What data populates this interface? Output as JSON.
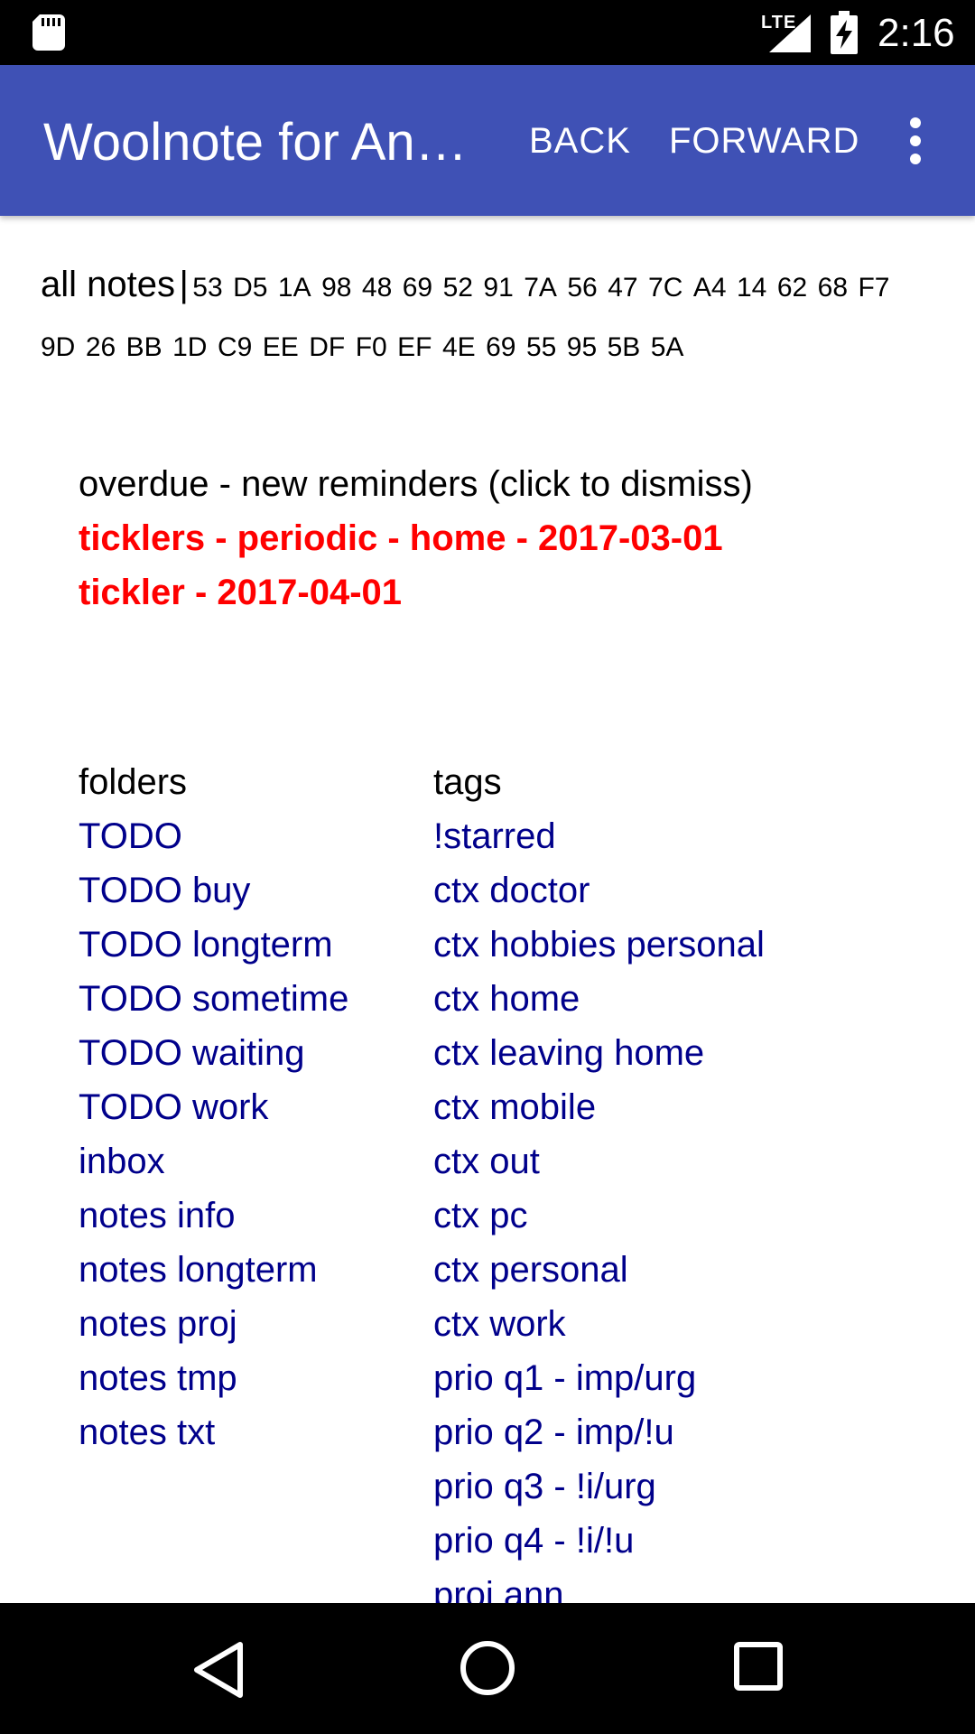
{
  "status_bar": {
    "network_label": "LTE",
    "time": "2:16",
    "icons": [
      "sd-card-icon",
      "signal-icon",
      "battery-charging-icon"
    ]
  },
  "app_bar": {
    "title": "Woolnote for An…",
    "back_label": "BACK",
    "forward_label": "FORWARD",
    "overflow_icon": "more-vert-icon",
    "color": "#3f51b5"
  },
  "header": {
    "all_notes_label": "all notes",
    "separator": "|",
    "ids": [
      "53",
      "D5",
      "1A",
      "98",
      "48",
      "69",
      "52",
      "91",
      "7A",
      "56",
      "47",
      "7C",
      "A4",
      "14",
      "62",
      "68",
      "F7",
      "9D",
      "26",
      "BB",
      "1D",
      "C9",
      "EE",
      "DF",
      "F0",
      "EF",
      "4E",
      "69",
      "55",
      "95",
      "5B",
      "5A"
    ]
  },
  "reminders": {
    "title": "overdue - new reminders (click to dismiss)",
    "items": [
      "ticklers - periodic - home - 2017-03-01",
      "tickler - 2017-04-01"
    ],
    "color": "#ff0000"
  },
  "folders": {
    "heading": "folders",
    "items": [
      "TODO",
      "TODO buy",
      "TODO longterm",
      "TODO sometime",
      "TODO waiting",
      "TODO work",
      "inbox",
      "notes info",
      "notes longterm",
      "notes proj",
      "notes tmp",
      "notes txt"
    ]
  },
  "tags": {
    "heading": "tags",
    "items": [
      "!starred",
      "ctx doctor",
      "ctx hobbies personal",
      "ctx home",
      "ctx leaving home",
      "ctx mobile",
      "ctx out",
      "ctx pc",
      "ctx personal",
      "ctx work",
      "prio q1 - imp/urg",
      "prio q2 - imp/!u",
      "prio q3 - !i/urg",
      "prio q4 - !i/!u",
      "proj ann"
    ]
  },
  "link_color": "#00008b",
  "scroll_top_button": {
    "label": "▲"
  },
  "nav_bar": {
    "icons": [
      "nav-back-icon",
      "nav-home-icon",
      "nav-recents-icon"
    ]
  }
}
